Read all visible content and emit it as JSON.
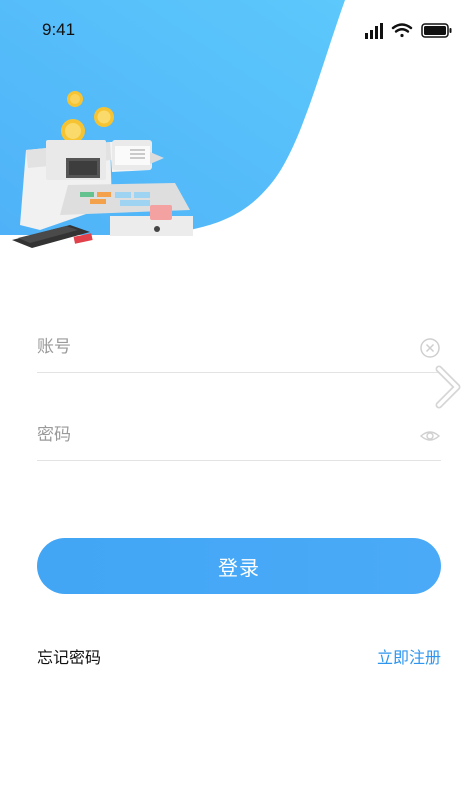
{
  "status_bar": {
    "time": "9:41",
    "icons": [
      "cellular-signal-icon",
      "wifi-icon",
      "battery-icon"
    ]
  },
  "header": {
    "illustration": "cash-register-illustration",
    "accent_color": "#5ab8f9"
  },
  "form": {
    "account": {
      "placeholder": "账号",
      "value": "",
      "clear_icon": "clear-circle-icon"
    },
    "password": {
      "placeholder": "密码",
      "value": "",
      "toggle_icon": "eye-icon"
    },
    "next_icon": "chevron-right-icon"
  },
  "actions": {
    "login_label": "登录",
    "forgot_label": "忘记密码",
    "register_label": "立即注册",
    "primary_color": "#42a6f5",
    "link_color": "#2e96ee"
  }
}
